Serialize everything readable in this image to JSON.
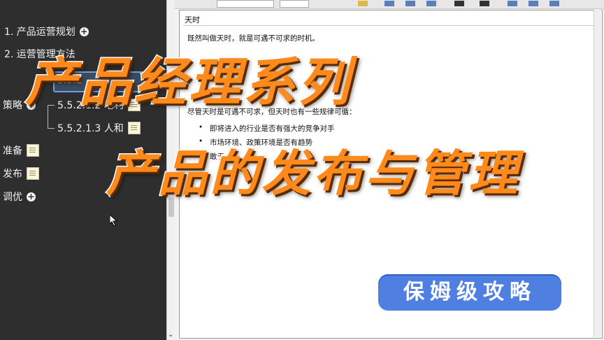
{
  "mindmap": {
    "nodes": [
      {
        "label": "1. 产品运营规划"
      },
      {
        "label": "2. 运营管理方法"
      },
      {
        "label": "5.5.2"
      },
      {
        "label": "策略"
      },
      {
        "label": "5.5.2.1.2 地利"
      },
      {
        "label": "5.5.2.1.3 人和"
      },
      {
        "label": "准备"
      },
      {
        "label": "发布"
      },
      {
        "label": "调优"
      }
    ]
  },
  "doc": {
    "title": "天时",
    "lines": [
      "既然叫做天时，就是可遇不可求的时机。",
      "尽管天时是可遇不可求，但天时也有一些规律可循：",
      "即将进入的行业是否有强大的竞争对手",
      "市场环境、政策环境是否有趋势",
      "敢于"
    ]
  },
  "overlay": {
    "title1": "产品经理系列",
    "title2": "产品的发布与管理",
    "badge": "保姆级攻略"
  },
  "colors": {
    "title_fill": "#ff8a1c",
    "badge_bg": "#4f7fe0",
    "panel_bg": "#2e2e2e"
  }
}
